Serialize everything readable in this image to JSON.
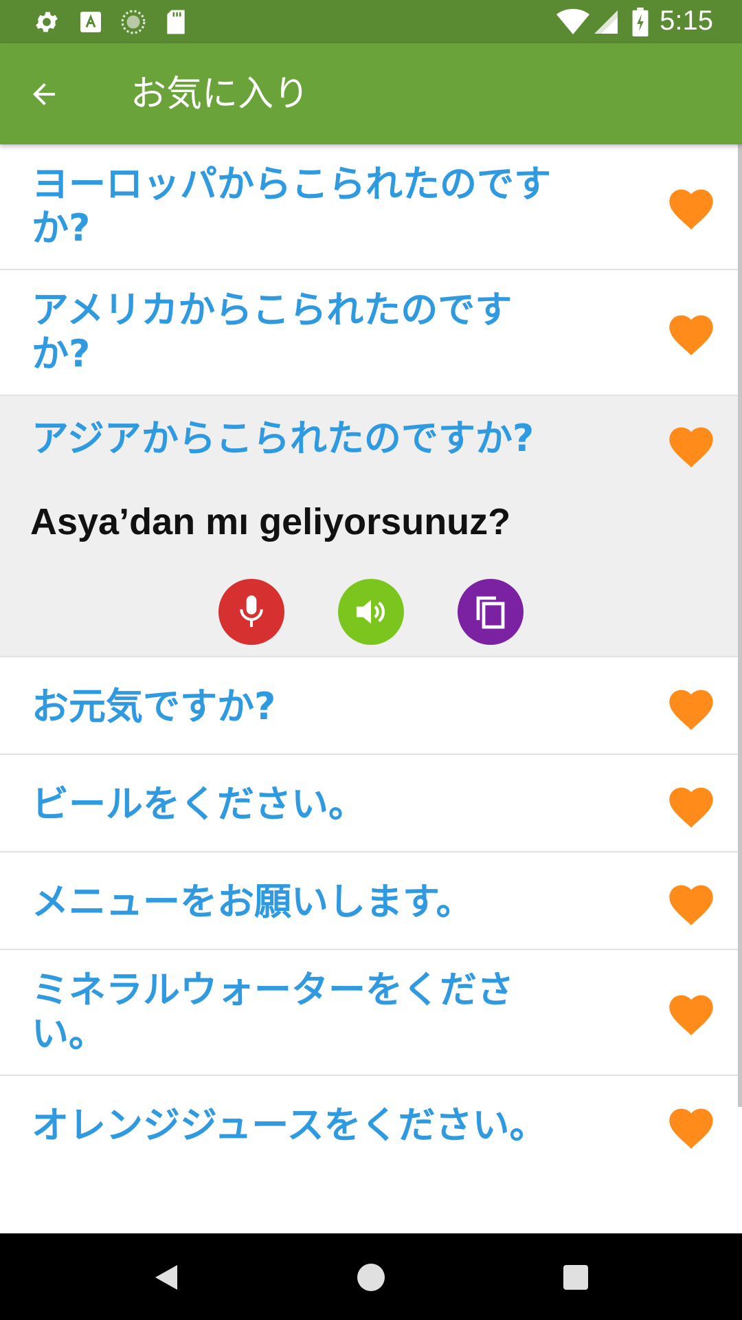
{
  "status_bar": {
    "time": "5:15",
    "left_icons": [
      "gear-icon",
      "font-a-icon",
      "sync-circle-icon",
      "sd-card-icon"
    ],
    "right_icons": [
      "wifi-icon",
      "cell-signal-icon",
      "battery-charging-icon"
    ]
  },
  "app_bar": {
    "title": "お気に入り",
    "back_icon": "arrow-left-icon"
  },
  "list": {
    "items": [
      {
        "phrase": "ヨーロッパからこられたのですか?"
      },
      {
        "phrase": "アメリカからこられたのですか?"
      },
      {
        "phrase": "アジアからこられたのですか?",
        "translation": "Asya’dan mı geliyorsunuz?"
      },
      {
        "phrase": "お元気ですか?"
      },
      {
        "phrase": "ビールをください。"
      },
      {
        "phrase": "メニューをお願いします。"
      },
      {
        "phrase": "ミネラルウォーターをください。"
      },
      {
        "phrase": "オレンジジュースをください。"
      }
    ],
    "expanded_actions": [
      {
        "icon": "microphone-icon",
        "color": "#d63030"
      },
      {
        "icon": "speaker-icon",
        "color": "#7cc51e"
      },
      {
        "icon": "copy-icon",
        "color": "#7b22a3"
      }
    ],
    "favorite_icon": "heart-icon",
    "favorite_color": "#ff8c1a",
    "phrase_color": "#2f9ae0"
  },
  "nav_bar": {
    "icons": [
      "nav-back-icon",
      "nav-home-icon",
      "nav-recents-icon"
    ]
  }
}
